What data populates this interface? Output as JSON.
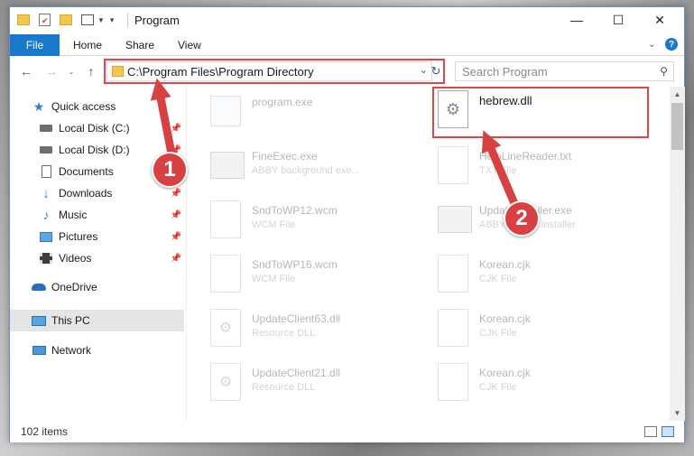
{
  "window": {
    "title": "Program"
  },
  "titlebar": {
    "minimize": "—",
    "maximize": "☐",
    "close": "✕"
  },
  "ribbon": {
    "tabs": [
      "File",
      "Home",
      "Share",
      "View"
    ]
  },
  "navbar": {
    "address": "C:\\Program Files\\Program Directory",
    "search_placeholder": "Search Program"
  },
  "sidebar": {
    "items": [
      {
        "label": "Quick access",
        "icon": "star-icon"
      },
      {
        "label": "Local Disk (C:)",
        "icon": "drive-icon",
        "pinned": true
      },
      {
        "label": "Local Disk (D:)",
        "icon": "drive-icon",
        "pinned": true
      },
      {
        "label": "Documents",
        "icon": "documents-icon",
        "pinned": true
      },
      {
        "label": "Downloads",
        "icon": "download-icon",
        "pinned": true
      },
      {
        "label": "Music",
        "icon": "music-icon",
        "pinned": true
      },
      {
        "label": "Pictures",
        "icon": "pictures-icon",
        "pinned": true
      },
      {
        "label": "Videos",
        "icon": "videos-icon",
        "pinned": true
      },
      {
        "label": "OneDrive",
        "icon": "cloud-icon"
      },
      {
        "label": "This PC",
        "icon": "computer-icon",
        "selected": true
      },
      {
        "label": "Network",
        "icon": "network-icon"
      }
    ]
  },
  "files": [
    {
      "name": "program.exe",
      "type": "",
      "icon": "exe-icon"
    },
    {
      "name": "hebrew.dll",
      "type": "",
      "icon": "dll-icon",
      "highlighted": true
    },
    {
      "name": "FineExec.exe",
      "type": "ABBY background exe...",
      "icon": "exe-icon"
    },
    {
      "name": "HelpLineReader.txt",
      "type": "TXT File",
      "icon": "txt-icon"
    },
    {
      "name": "SndToWP12.wcm",
      "type": "WCM File",
      "icon": "file-icon"
    },
    {
      "name": "UpdateInstaller.exe",
      "type": "ABBY update installer",
      "icon": "exe-icon"
    },
    {
      "name": "SndToWP16.wcm",
      "type": "WCM File",
      "icon": "file-icon"
    },
    {
      "name": "Korean.cjk",
      "type": "CJK File",
      "icon": "file-icon"
    },
    {
      "name": "UpdateClient63.dll",
      "type": "Resource DLL",
      "icon": "dll-icon"
    },
    {
      "name": "Korean.cjk",
      "type": "CJK File",
      "icon": "file-icon"
    },
    {
      "name": "UpdateClient21.dll",
      "type": "Resource DLL",
      "icon": "dll-icon"
    },
    {
      "name": "Korean.cjk",
      "type": "CJK File",
      "icon": "file-icon"
    }
  ],
  "status": {
    "item_count": "102 items"
  },
  "annotations": {
    "marker1": "1",
    "marker2": "2"
  },
  "colors": {
    "accent": "#1979ca",
    "highlight": "#e04646"
  }
}
